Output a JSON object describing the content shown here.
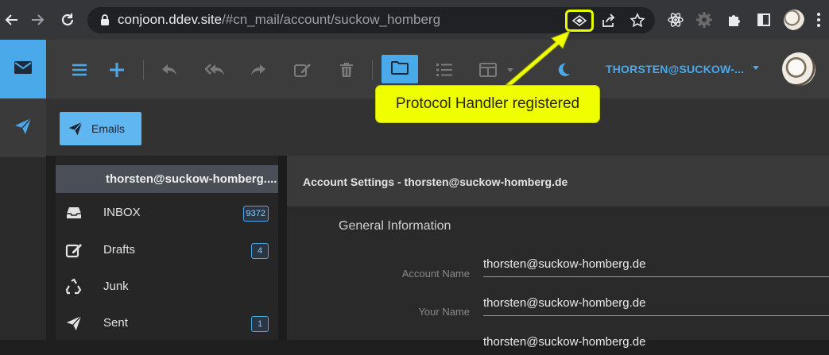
{
  "browser": {
    "url_host": "conjoon.ddev.site",
    "url_path": "/#cn_mail/account/suckow_homberg",
    "icons": [
      "back-icon",
      "forward-icon",
      "reload-icon",
      "lock-icon",
      "protocol-handler-icon",
      "share-icon",
      "bookmark-star-icon",
      "react-devtools-icon",
      "extension-gear-icon",
      "extensions-puzzle-icon",
      "side-panel-icon",
      "profile-avatar",
      "kebab-menu-icon"
    ]
  },
  "toolbar": {
    "user_label": "THORSTEN@SUCKOW-...",
    "icons": [
      "hamburger-icon",
      "plus-icon",
      "reply-icon",
      "reply-all-icon",
      "forward-icon",
      "edit-icon",
      "trash-icon",
      "folder-icon",
      "list-icon",
      "columns-icon",
      "moon-icon"
    ],
    "accent": "#4aa9e9"
  },
  "tabs": [
    {
      "label": "Emails",
      "icon": "paper-plane-icon",
      "active": true
    }
  ],
  "nav": {
    "account": "thorsten@suckow-homberg....",
    "folders": [
      {
        "label": "INBOX",
        "icon": "inbox-icon",
        "badge": "9372"
      },
      {
        "label": "Drafts",
        "icon": "edit-icon",
        "badge": "4"
      },
      {
        "label": "Junk",
        "icon": "recycle-icon",
        "badge": ""
      },
      {
        "label": "Sent",
        "icon": "paper-plane-icon",
        "badge": "1"
      }
    ]
  },
  "settings": {
    "header": "Account Settings - thorsten@suckow-homberg.de",
    "section": "General Information",
    "fields": [
      {
        "label": "Account Name",
        "value": "thorsten@suckow-homberg.de"
      },
      {
        "label": "Your Name",
        "value": "thorsten@suckow-homberg.de"
      },
      {
        "label": "",
        "value": "thorsten@suckow-homberg.de"
      }
    ]
  },
  "callout": {
    "text": "Protocol Handler registered",
    "color": "#f0ff00"
  }
}
